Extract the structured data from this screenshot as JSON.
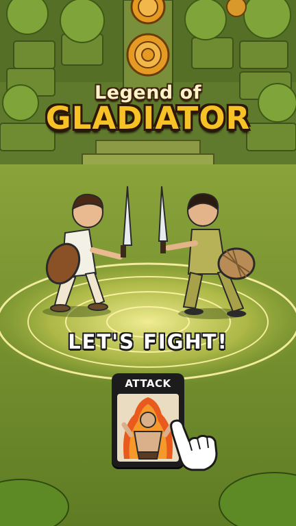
{
  "title": {
    "line1": "Legend of",
    "line2": "GLADIATOR"
  },
  "banner": {
    "text": "LET'S FIGHT!"
  },
  "attack_card": {
    "label": "ATTACK"
  },
  "icons": [
    "gladiator-hero-icon",
    "pointing-hand-icon"
  ],
  "colors": {
    "title_gold": "#f6c226",
    "grass": "#7c9a2e",
    "stone": "#6c7a33",
    "magic_circle": "#fff2a0"
  }
}
